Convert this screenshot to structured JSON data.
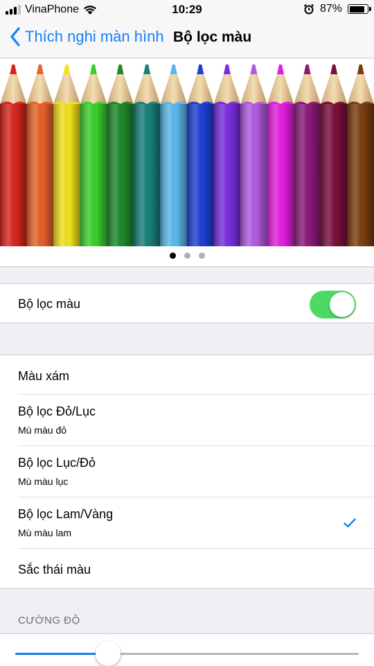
{
  "status": {
    "carrier": "VinaPhone",
    "time": "10:29",
    "battery": "87%",
    "battery_level": 0.87
  },
  "nav": {
    "back_label": "Thích nghi màn hình",
    "title": "Bộ lọc màu"
  },
  "preview": {
    "pencil_colors": [
      "#d9251f",
      "#e8612a",
      "#f2e21b",
      "#39d12c",
      "#1c8a2a",
      "#17807c",
      "#5ab8ec",
      "#1f3fd6",
      "#7a2ee0",
      "#b05be0",
      "#e21ee0",
      "#8a1a7a",
      "#7a0f3a",
      "#7a3e10"
    ],
    "pages": 3,
    "active_page": 0
  },
  "filter_toggle": {
    "label": "Bộ lọc màu",
    "on": true
  },
  "filters": [
    {
      "name": "Màu xám",
      "sub": "",
      "checked": false
    },
    {
      "name": "Bộ lọc Đỏ/Lục",
      "sub": "Mù màu đỏ",
      "checked": false
    },
    {
      "name": "Bộ lọc Lục/Đỏ",
      "sub": "Mù màu lục",
      "checked": false
    },
    {
      "name": "Bộ lọc Lam/Vàng",
      "sub": "Mù màu lam",
      "checked": true
    },
    {
      "name": "Sắc thái màu",
      "sub": "",
      "checked": false
    }
  ],
  "intensity": {
    "header": "CƯỜNG ĐỘ",
    "value": 0.27
  },
  "colors": {
    "accent": "#147efb",
    "toggle_on": "#4cd964"
  }
}
